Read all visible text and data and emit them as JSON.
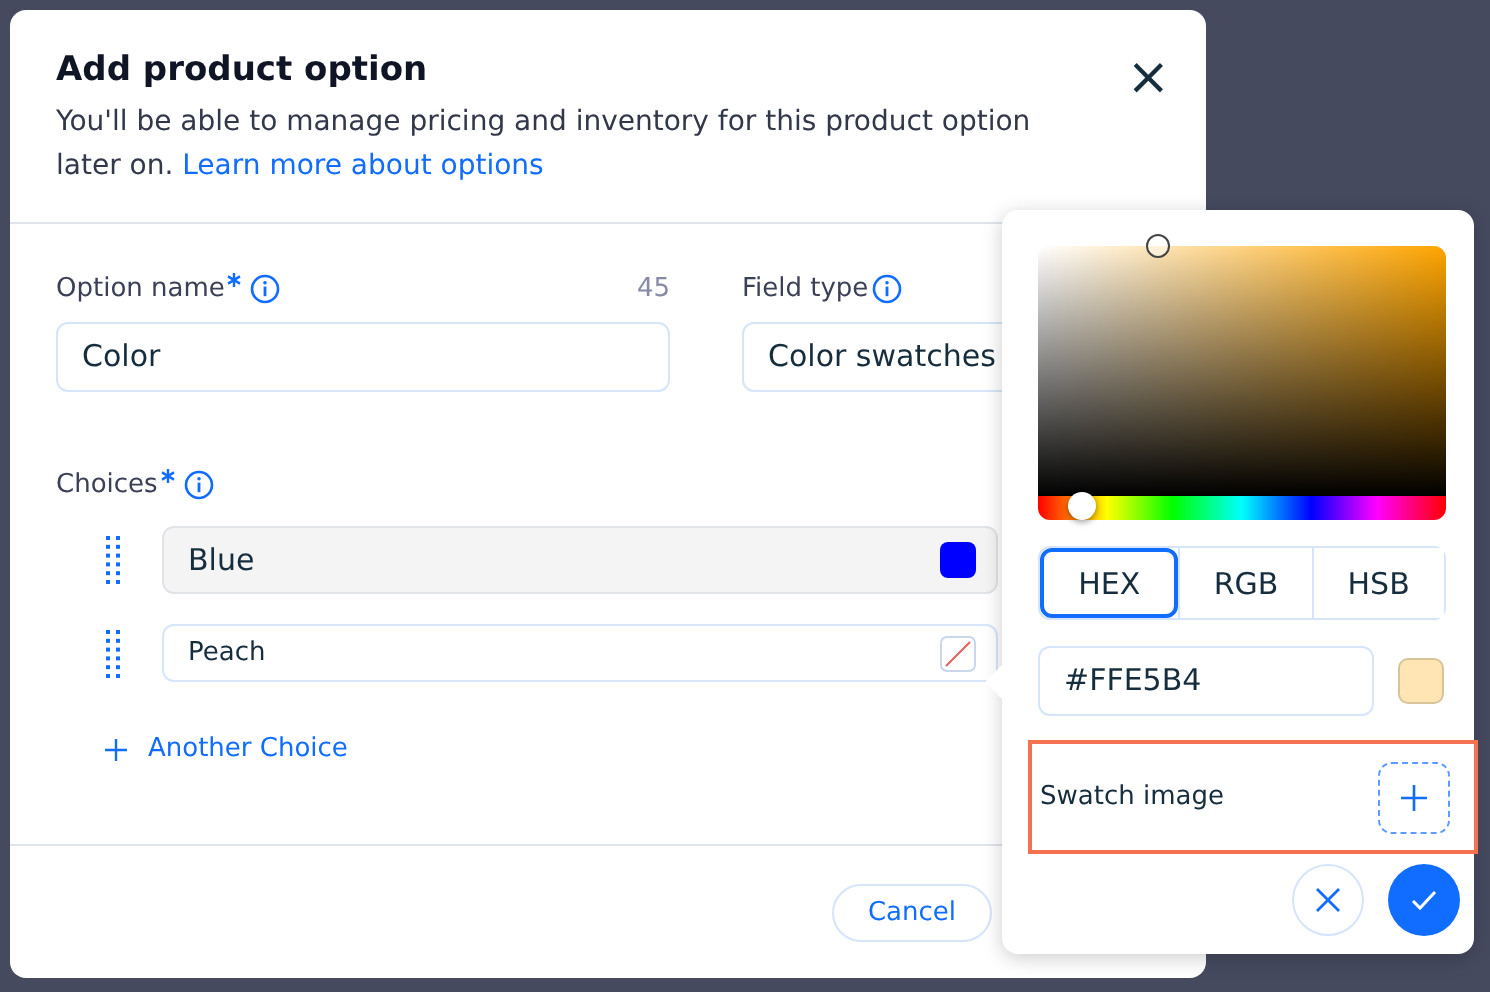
{
  "dialog": {
    "title": "Add product option",
    "description": "You'll be able to manage pricing and inventory for this product option later on.",
    "link": "Learn more about options",
    "close": "×"
  },
  "option_name": {
    "label": "Option name",
    "required": true,
    "count": "45",
    "value": "Color"
  },
  "field_type": {
    "label": "Field type",
    "value": "Color swatches"
  },
  "choices": {
    "label": "Choices",
    "required": true,
    "items": [
      {
        "name": "Blue",
        "kind": "color",
        "color": "#0000ff",
        "selected": false
      },
      {
        "name": "Peach",
        "kind": "none",
        "selected": true
      }
    ]
  },
  "add_choice": "Another Choice",
  "footer": {
    "cancel": "Cancel"
  },
  "color_picker": {
    "hue": {
      "level": 0.11
    },
    "modes": [
      {
        "label": "HEX",
        "selected": true
      },
      {
        "label": "RGB",
        "selected": false
      },
      {
        "label": "HSB",
        "selected": false
      }
    ],
    "hex_value": "#FFE5B4",
    "swatch_image": {
      "label": "Swatch image",
      "highlighted": true
    }
  }
}
